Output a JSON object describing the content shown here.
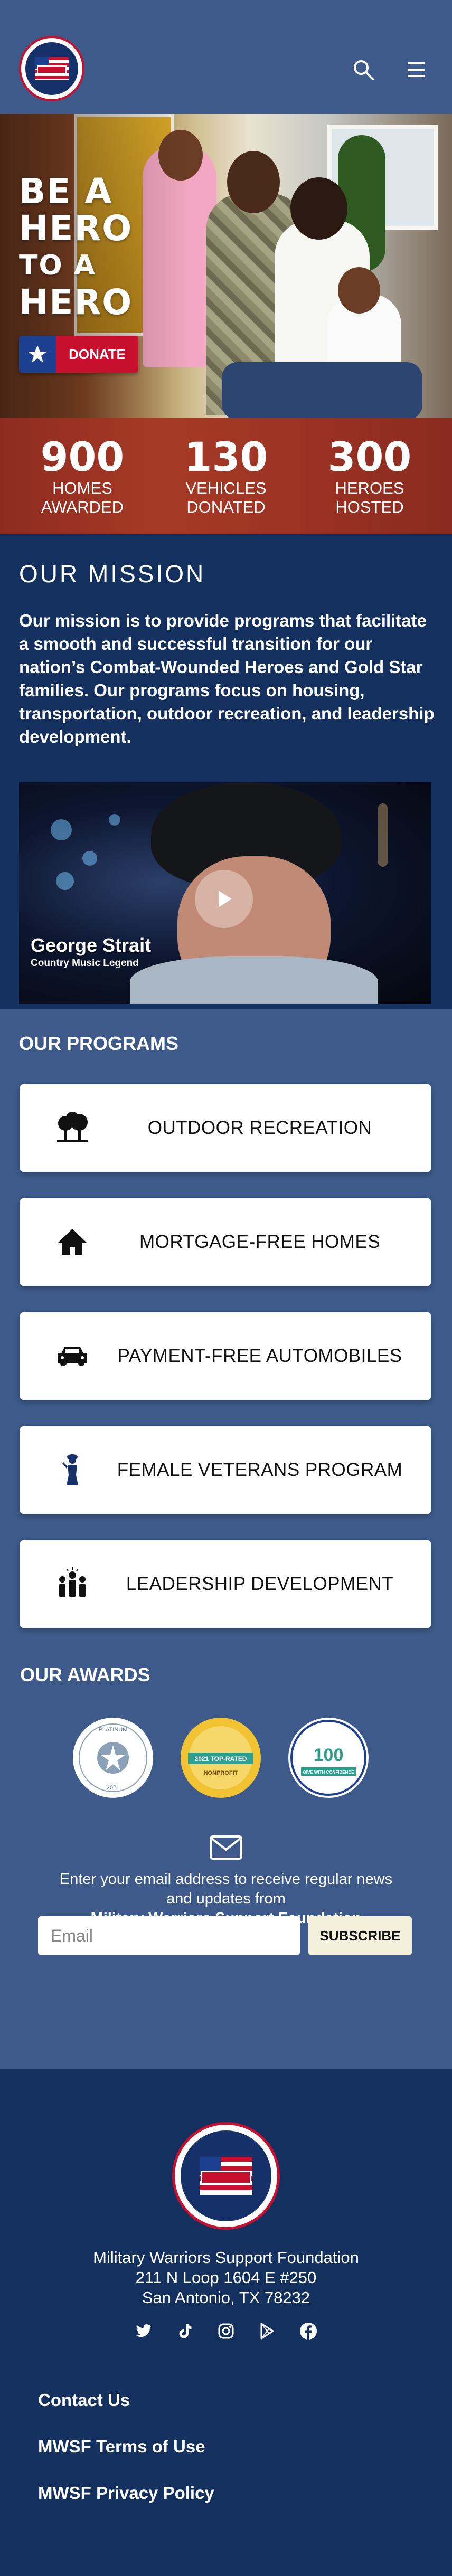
{
  "header": {
    "logo_alt_text": "Military Warriors Support Foundation – Heroes",
    "search_icon": "search-icon",
    "menu_icon": "hamburger-menu-icon"
  },
  "hero": {
    "tagline_1": "BE A",
    "tagline_2": "HERO",
    "tagline_3": "TO A",
    "tagline_4": "HERO",
    "donate_label": "DONATE"
  },
  "stats": [
    {
      "number": "900",
      "line1": "HOMES",
      "line2": "AWARDED"
    },
    {
      "number": "130",
      "line1": "VEHICLES",
      "line2": "DONATED"
    },
    {
      "number": "300",
      "line1": "HEROES",
      "line2": "HOSTED"
    }
  ],
  "mission": {
    "title": "OUR MISSION",
    "body": "Our mission is to provide programs that facilitate a smooth and successful transition for our nation’s Combat-Wounded Heroes and Gold Star families. Our programs focus on housing, transportation, outdoor recreation, and leadership development.",
    "video_name": "George Strait",
    "video_subtitle": "Country Music Legend"
  },
  "programs": {
    "title": "OUR PROGRAMS",
    "items": [
      {
        "label": "OUTDOOR RECREATION",
        "icon": "trees-icon"
      },
      {
        "label": "MORTGAGE-FREE HOMES",
        "icon": "house-icon"
      },
      {
        "label": "PAYMENT-FREE AUTOMOBILES",
        "icon": "car-icon"
      },
      {
        "label": "FEMALE VETERANS PROGRAM",
        "icon": "female-soldier-icon"
      },
      {
        "label": "LEADERSHIP DEVELOPMENT",
        "icon": "group-leader-icon"
      }
    ]
  },
  "awards": {
    "title": "OUR AWARDS",
    "items": [
      {
        "name": "GuideStar Platinum Transparency 2021",
        "line1": "PLATINUM",
        "line2": "2021"
      },
      {
        "name": "GreatNonprofits 2021 Top-Rated Nonprofit",
        "line1": "2021 TOP-RATED",
        "line2": "NONPROFIT"
      },
      {
        "name": "Charity Navigator 100 out of 100",
        "line1": "100",
        "line2": "GIVE WITH CONFIDENCE"
      }
    ]
  },
  "newsletter": {
    "text": "Enter your email address to receive regular news and updates from",
    "org": "Military Warriors Support Foundation",
    "email_placeholder": "Email",
    "subscribe_label": "SUBSCRIBE"
  },
  "footer": {
    "address_line1": "Military Warriors Support Foundation",
    "address_line2": "211 N Loop 1604 E #250",
    "address_line3": "San Antonio, TX 78232",
    "links": [
      "Contact Us",
      "MWSF Terms of Use",
      "MWSF Privacy Policy"
    ]
  },
  "colors": {
    "navy": "#13305f",
    "slate_blue": "#3d5a8a",
    "red": "#c8102e",
    "white": "#ffffff"
  }
}
